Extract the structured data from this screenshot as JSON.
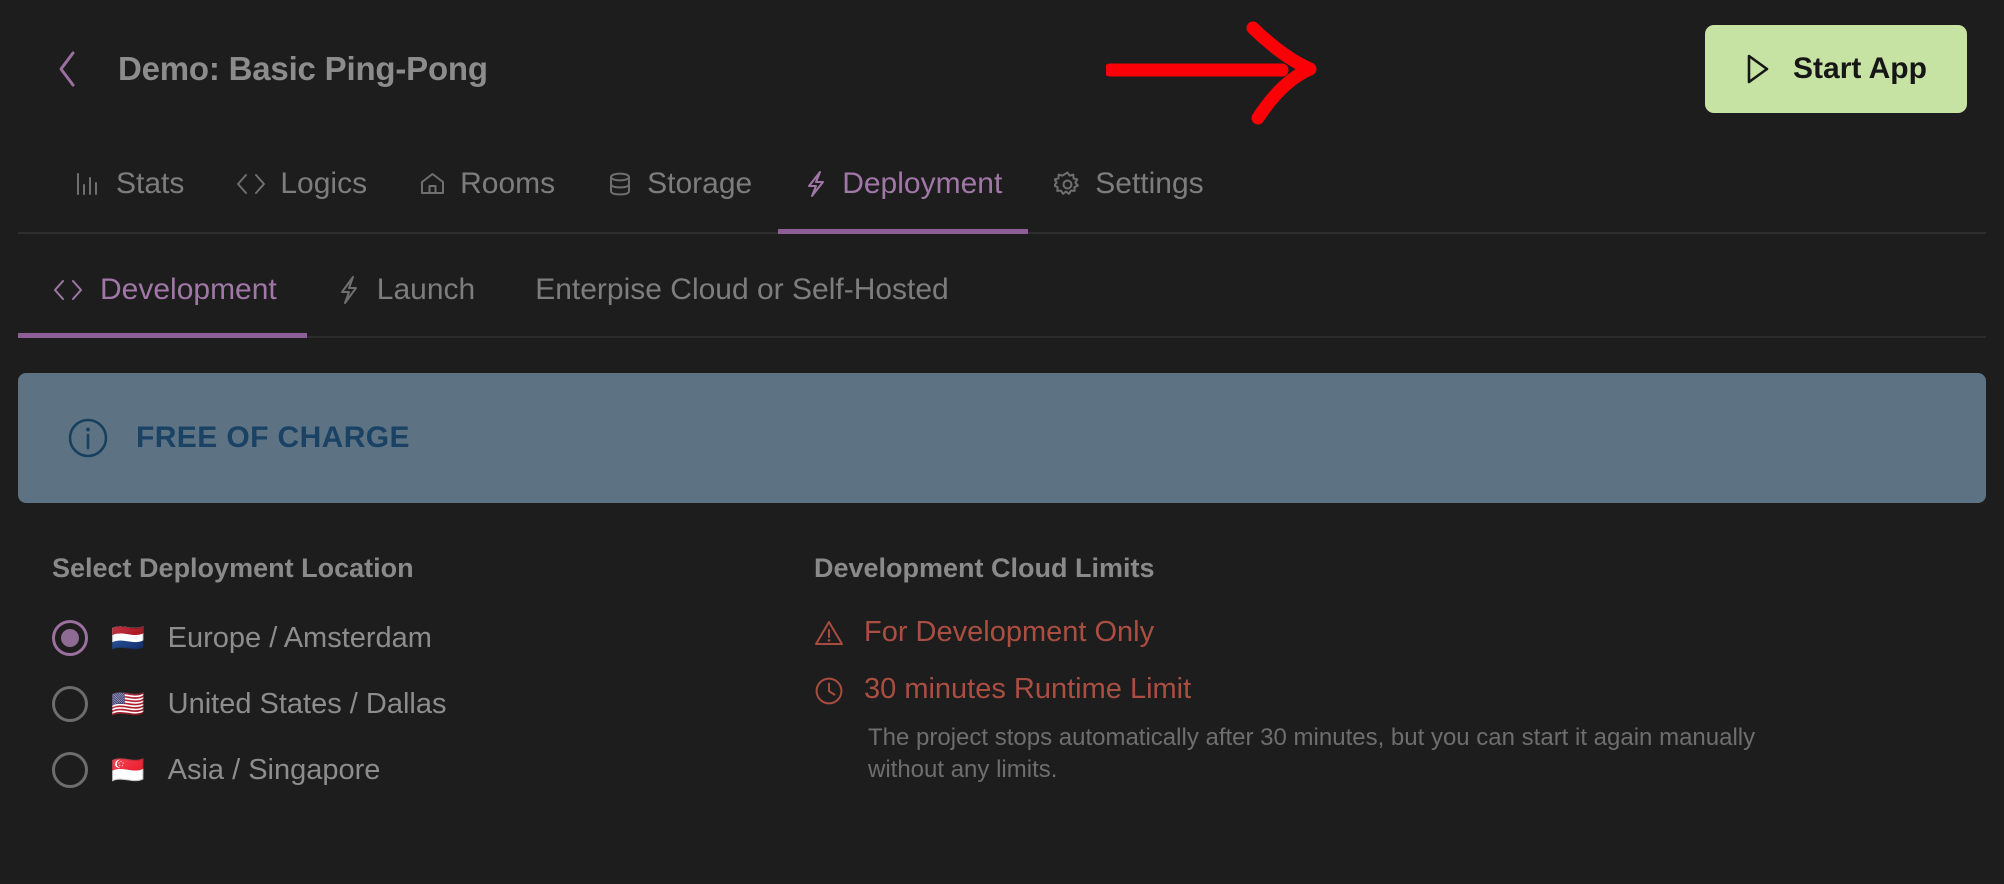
{
  "header": {
    "back_icon": "chevron-left-icon",
    "title": "Demo: Basic Ping-Pong",
    "start_button_label": "Start App",
    "start_button_icon": "play-icon",
    "start_button_color": "#c6e3a4"
  },
  "annotation": {
    "type": "arrow",
    "color": "#fb0007",
    "points_to": "start-app-button"
  },
  "main_tabs": [
    {
      "label": "Stats",
      "icon": "bar-chart-icon",
      "active": false
    },
    {
      "label": "Logics",
      "icon": "code-brackets-icon",
      "active": false
    },
    {
      "label": "Rooms",
      "icon": "home-icon",
      "active": false
    },
    {
      "label": "Storage",
      "icon": "database-icon",
      "active": false
    },
    {
      "label": "Deployment",
      "icon": "lightning-bolt-icon",
      "active": true
    },
    {
      "label": "Settings",
      "icon": "gear-icon",
      "active": false
    }
  ],
  "sub_tabs": [
    {
      "label": "Development",
      "icon": "code-brackets-icon",
      "active": true
    },
    {
      "label": "Launch",
      "icon": "lightning-bolt-icon",
      "active": false
    },
    {
      "label": "Enterpise Cloud or Self-Hosted",
      "icon": "",
      "active": false
    }
  ],
  "banner": {
    "icon": "info-circle-icon",
    "text": "FREE OF CHARGE",
    "bg_color": "#5d7383",
    "text_color": "#1a4264"
  },
  "deployment_location": {
    "title": "Select Deployment Location",
    "options": [
      {
        "label": "Europe / Amsterdam",
        "flag": "🇳🇱",
        "selected": true
      },
      {
        "label": "United States / Dallas",
        "flag": "🇺🇸",
        "selected": false
      },
      {
        "label": "Asia / Singapore",
        "flag": "🇸🇬",
        "selected": false
      }
    ]
  },
  "cloud_limits": {
    "title": "Development Cloud Limits",
    "accent_color": "#ab4e42",
    "items": [
      {
        "icon": "warning-triangle-icon",
        "title": "For Development Only",
        "description": ""
      },
      {
        "icon": "clock-icon",
        "title": "30 minutes Runtime Limit",
        "description": "The project stops automatically after 30 minutes, but you can start it again manually without any limits."
      }
    ]
  }
}
